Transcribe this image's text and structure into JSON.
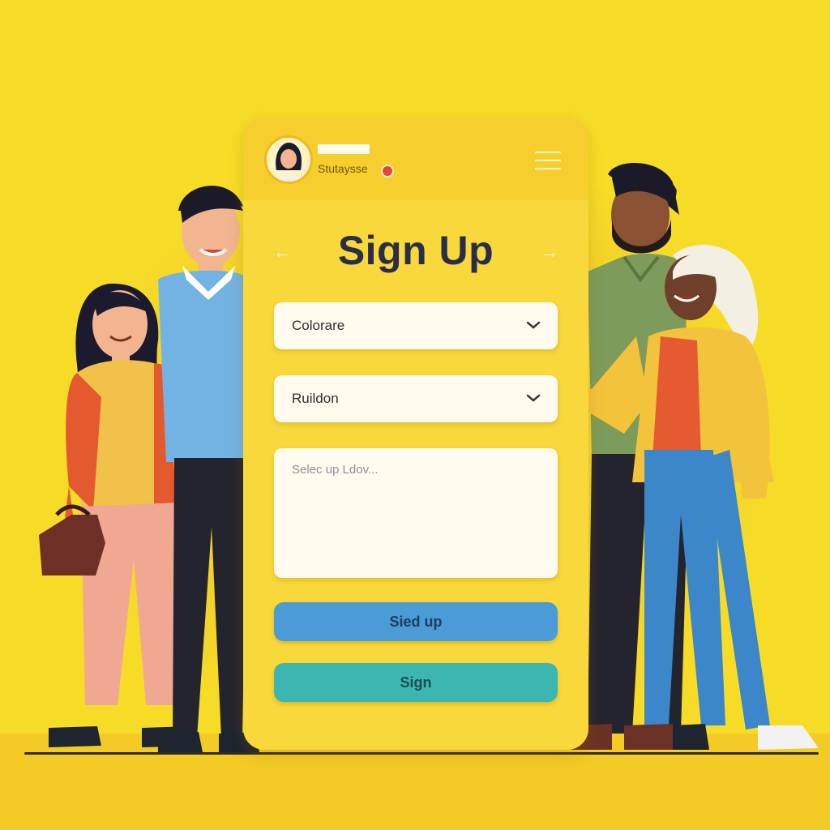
{
  "colors": {
    "background": "#f7dc27",
    "card": "#f8d83a",
    "title": "#2a2d4a",
    "primary_button": "#4a9bd6",
    "secondary_button": "#3cb6b0",
    "notification": "#e4473a"
  },
  "header": {
    "username": "Stutaysse",
    "icons": [
      "avatar",
      "notification-dot",
      "hamburger-menu-icon"
    ]
  },
  "form": {
    "title": "Sign Up",
    "prev_icon": "←",
    "next_icon": "→",
    "select_1": "Colorare",
    "select_2": "Ruildon",
    "textarea_placeholder": "Selec up Ldov...",
    "primary_button": "Sied up",
    "secondary_button": "Sign"
  }
}
